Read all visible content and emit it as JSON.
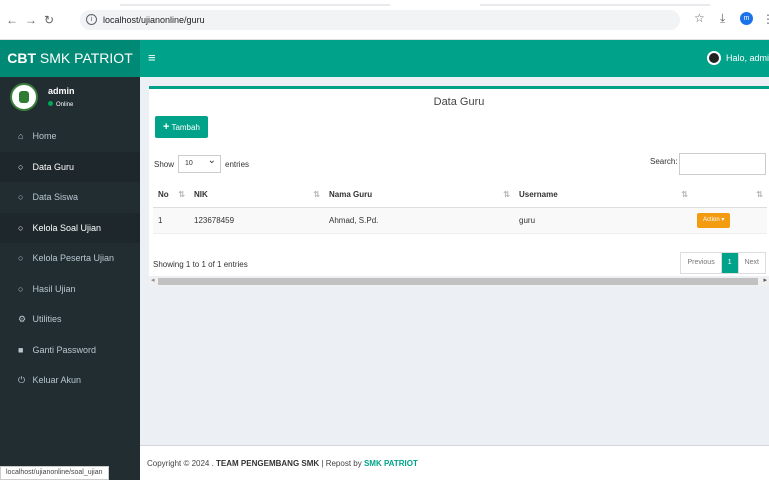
{
  "browser": {
    "url": "localhost/ujianonline/guru"
  },
  "header": {
    "logo_bold": "CBT",
    "logo_rest": " SMK PATRIOT",
    "menu_toggle": "≡",
    "greeting": "Halo, admi"
  },
  "sidebar": {
    "user_name": "admin",
    "user_status": "Online",
    "items": [
      {
        "label": "Home",
        "icon": "home-icon",
        "glyph": "⌂"
      },
      {
        "label": "Data Guru",
        "icon": "circle-icon",
        "glyph": "○"
      },
      {
        "label": "Data Siswa",
        "icon": "circle-icon",
        "glyph": "○"
      },
      {
        "label": "Kelola Soal Ujian",
        "icon": "circle-icon",
        "glyph": "○"
      },
      {
        "label": "Kelola Peserta Ujian",
        "icon": "circle-icon",
        "glyph": "○"
      },
      {
        "label": "Hasil Ujian",
        "icon": "circle-icon",
        "glyph": "○"
      },
      {
        "label": "Utilities",
        "icon": "cogs-icon",
        "glyph": "⚙"
      },
      {
        "label": "Ganti Password",
        "icon": "lock-icon",
        "glyph": "■"
      },
      {
        "label": "Keluar Akun",
        "icon": "power-icon",
        "glyph": "⏻"
      }
    ]
  },
  "main": {
    "box_title": "Data Guru",
    "add_button": "Tambah",
    "show_label": "Show",
    "entries_value": "10",
    "entries_label": "entries",
    "search_label": "Search:",
    "columns": [
      "No",
      "NIK",
      "Nama Guru",
      "Username",
      ""
    ],
    "rows": [
      {
        "no": "1",
        "nik": "123678459",
        "nama": "Ahmad, S.Pd.",
        "username": "guru",
        "action": "Action"
      }
    ],
    "info": "Showing 1 to 1 of 1 entries",
    "pager": {
      "previous": "Previous",
      "current": "1",
      "next": "Next"
    }
  },
  "footer": {
    "prefix": "Copyright © 2024 . ",
    "team": "TEAM PENGEMBANG SMK",
    "separator": " | Repost by ",
    "brand": "SMK PATRIOT"
  },
  "status_bar_url": "localhost/ujianonline/soal_ujian",
  "colors": {
    "accent": "#00a28a",
    "sidebar": "#222d32",
    "action": "#f39c12"
  }
}
